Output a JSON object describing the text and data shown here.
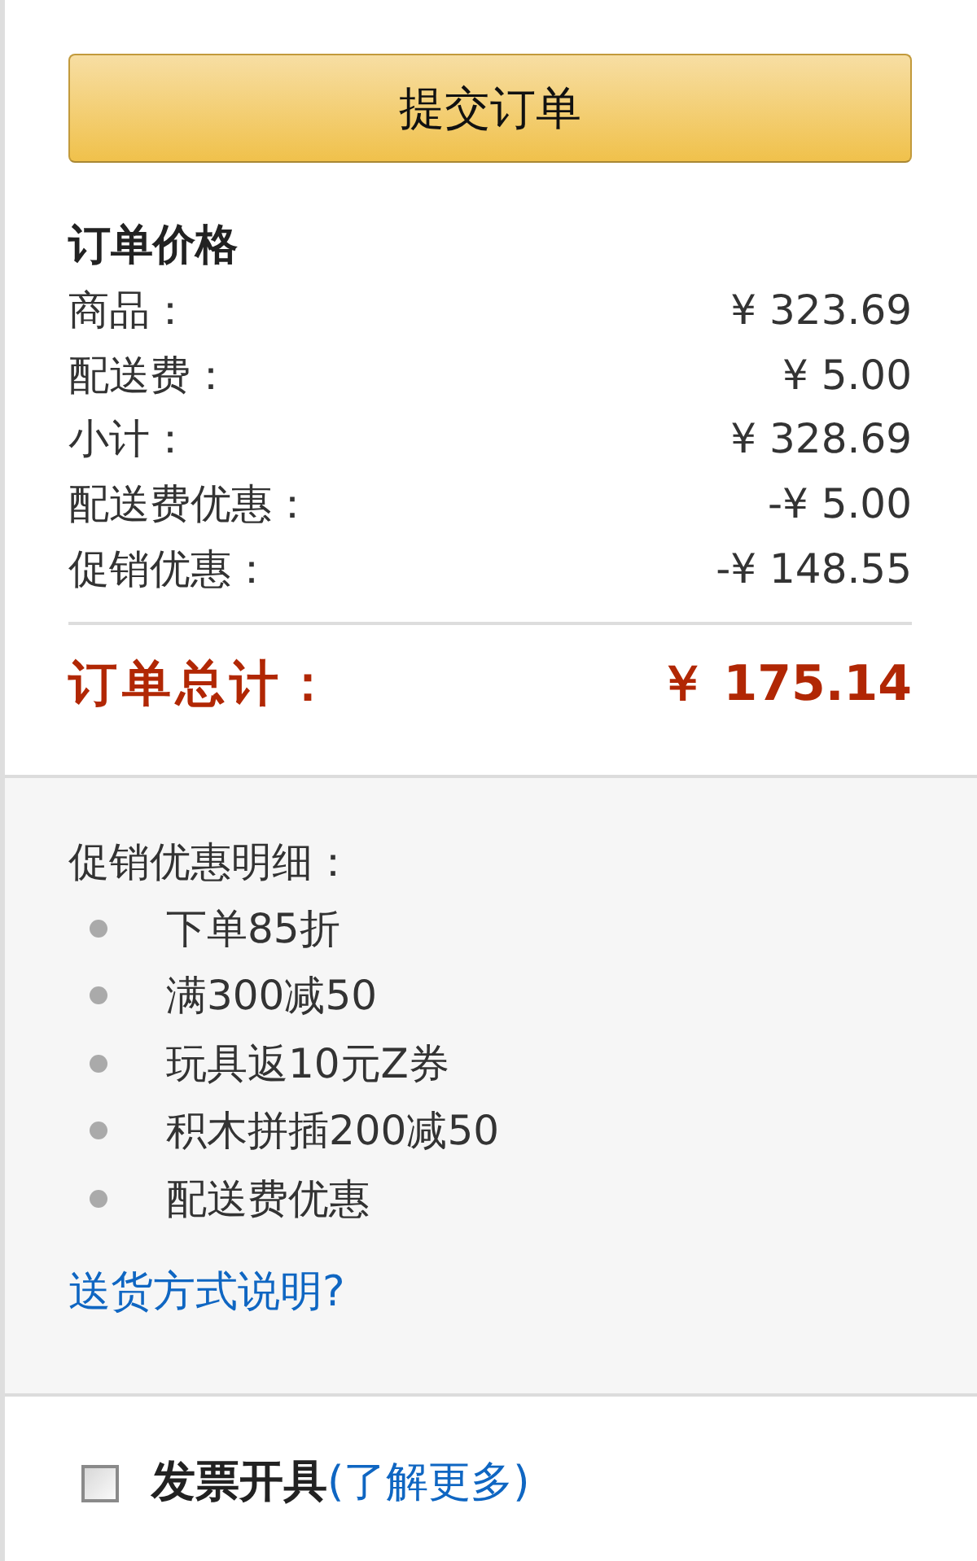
{
  "submit_button": {
    "label": "提交订单"
  },
  "order_price": {
    "title": "订单价格",
    "rows": [
      {
        "label": "商品：",
        "amount": "¥ 323.69"
      },
      {
        "label": "配送费：",
        "amount": "¥ 5.00"
      },
      {
        "label": "小计：",
        "amount": "¥ 328.69"
      },
      {
        "label": "配送费优惠：",
        "amount": "-¥ 5.00"
      },
      {
        "label": "促销优惠：",
        "amount": "-¥ 148.55"
      }
    ],
    "total": {
      "label": "订单总计：",
      "amount": "￥ 175.14"
    }
  },
  "promotion_details": {
    "title": "促销优惠明细：",
    "items": [
      "下单85折",
      "满300减50",
      "玩具返10元Z券",
      "积木拼插200减50",
      "配送费优惠"
    ],
    "link": "送货方式说明?"
  },
  "invoice": {
    "checked": false,
    "label": "发票开具",
    "link": "(了解更多)"
  }
}
